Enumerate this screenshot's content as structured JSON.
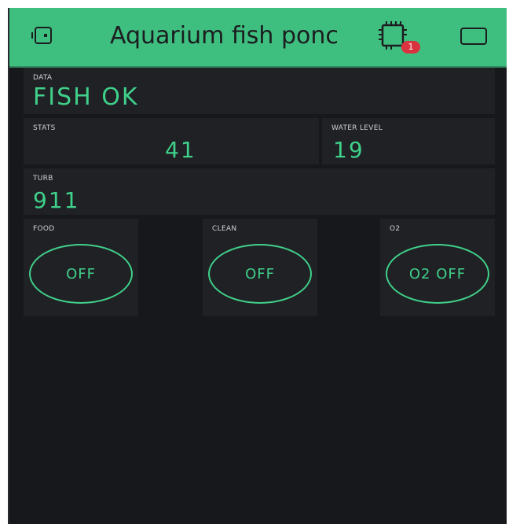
{
  "header": {
    "title": "Aquarium fish ponc",
    "notification_count": "1",
    "icons": [
      "device-icon",
      "hardware-chip-icon",
      "square-icon"
    ]
  },
  "widgets": {
    "data": {
      "label": "DATA",
      "value": "FISH OK"
    },
    "stats": {
      "label": "STATS",
      "value": "41"
    },
    "water_level": {
      "label": "WATER LEVEL",
      "value": "19"
    },
    "turb": {
      "label": "TURB",
      "value": "911"
    }
  },
  "buttons": {
    "food": {
      "label": "FOOD",
      "state": "OFF"
    },
    "clean": {
      "label": "CLEAN",
      "state": "OFF"
    },
    "o2": {
      "label": "O2",
      "state": "O2 OFF"
    }
  },
  "colors": {
    "accent": "#3fbf7f",
    "value_green": "#3fd08a",
    "background": "#17181c",
    "widget_bg": "#202125",
    "badge_red": "#d9333f"
  }
}
